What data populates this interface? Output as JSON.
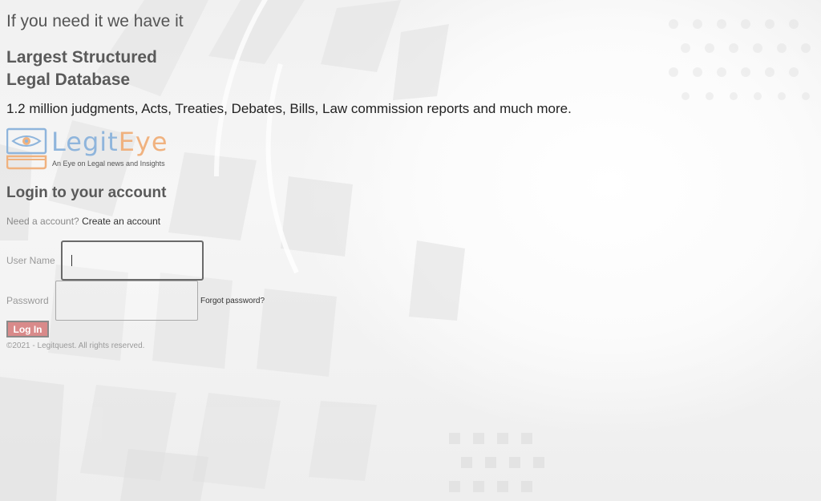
{
  "hero": {
    "tagline": "If you need it we have it",
    "headline_line1": "Largest Structured",
    "headline_line2": "Legal Database",
    "description": "1.2 million judgments, Acts, Treaties, Debates, Bills, Law commission reports and much more."
  },
  "logo": {
    "word_part1": "Legit",
    "word_part2": "Eye",
    "tagline": "An Eye on Legal news and Insights",
    "icon": "eye-laptop-icon",
    "colors": {
      "blue": "#8fb5dc",
      "orange": "#f0b27f"
    }
  },
  "login": {
    "title": "Login to your account",
    "need_account_text": "Need a account?",
    "create_account_link": "Create an account",
    "username_label": "User Name",
    "username_value": "",
    "password_label": "Password",
    "password_value": "",
    "forgot_password_link": "Forgot password?",
    "login_button": "Log In",
    "button_color": "#d98a8a"
  },
  "footer": {
    "copyright": "©2021 - Legitquest. All rights reserved."
  }
}
